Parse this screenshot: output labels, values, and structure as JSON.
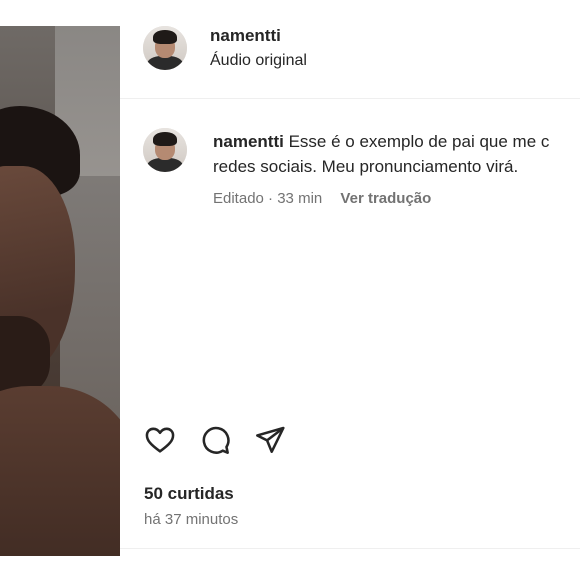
{
  "post": {
    "username": "namentti",
    "audio": "Áudio original"
  },
  "comment": {
    "username": "namentti",
    "text_line1": "Esse é o exemplo de pai que me c",
    "text_line2": "redes sociais. Meu pronunciamento virá.",
    "edited": "Editado",
    "separator": "·",
    "age": "33 min",
    "translate": "Ver tradução"
  },
  "actions": {
    "like_icon": "heart-icon",
    "comment_icon": "comment-icon",
    "share_icon": "send-icon"
  },
  "stats": {
    "likes": "50 curtidas",
    "posted": "há 37 minutos"
  }
}
